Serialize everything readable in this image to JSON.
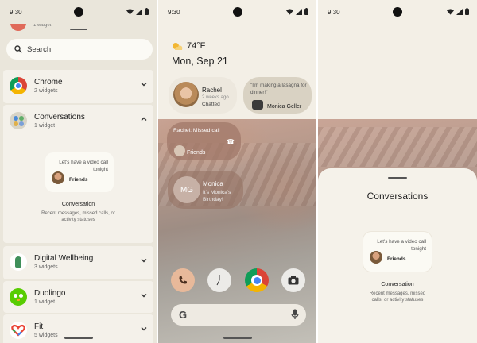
{
  "status": {
    "time": "9:30"
  },
  "picker": {
    "partial_row_sub": "1 widget",
    "search_placeholder": "Search",
    "search_ghost": "1 widgets",
    "apps": [
      {
        "name": "Chrome",
        "count": "2 widgets",
        "expanded": false
      },
      {
        "name": "Conversations",
        "count": "1 widget",
        "expanded": true
      },
      {
        "name": "Digital Wellbeing",
        "count": "3 widgets",
        "expanded": false
      },
      {
        "name": "Duolingo",
        "count": "1 widget",
        "expanded": false
      },
      {
        "name": "Fit",
        "count": "5 widgets",
        "expanded": false
      }
    ],
    "preview": {
      "message": "Let's have a video call tonight",
      "from": "Friends",
      "title": "Conversation",
      "description": "Recent messages, missed calls, or activity statuses"
    }
  },
  "home": {
    "weather": "74°F",
    "date": "Mon, Sep 21",
    "widgets": {
      "rachel": {
        "name": "Rachel",
        "time": "2 weeks ago",
        "status": "Chatted"
      },
      "lasagna": {
        "message": "\"I'm making a lasagna for dinner!\"",
        "from": "Monica Geller"
      },
      "missed": {
        "message": "Rachel: Missed call",
        "from": "Friends"
      },
      "monica": {
        "initials": "MG",
        "name": "Monica",
        "birthday": "It's Monica's Birthday!"
      }
    },
    "search_logo": "G"
  },
  "sheet": {
    "title": "Conversations",
    "card_message": "Let's have a video call tonight",
    "card_from": "Friends",
    "widget_title": "Conversation",
    "widget_description": "Recent messages, missed calls, or activity statuses"
  },
  "colors": {
    "picker_bg": "#eae6db",
    "row_bg": "#f4f1ea",
    "sheet_bg": "#f5f2ea",
    "rachel_widget": "#ede8de",
    "lasagna_widget": "#d9d2c3"
  }
}
